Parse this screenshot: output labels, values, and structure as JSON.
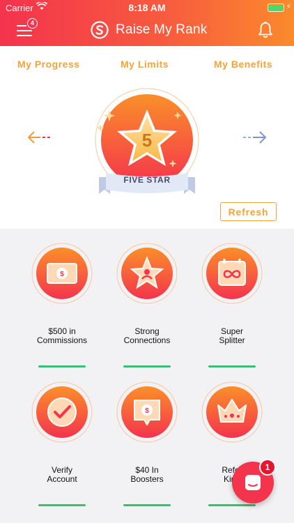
{
  "status_bar": {
    "carrier": "Carrier",
    "time": "8:18 AM"
  },
  "header": {
    "title": "Raise My Rank",
    "menu_badge": "4",
    "menu_icon": "hamburger-menu-icon",
    "bell_icon": "bell-icon",
    "logo_icon": "s-logo-icon"
  },
  "tabs": [
    {
      "label": "My Progress"
    },
    {
      "label": "My Limits"
    },
    {
      "label": "My Benefits"
    }
  ],
  "rank": {
    "number": "5",
    "label": "FIVE STAR"
  },
  "refresh_label": "Refresh",
  "benefits": [
    {
      "title": "$500 in\nCommissions",
      "icon": "money-bill-icon"
    },
    {
      "title": "Strong\nConnections",
      "icon": "star-person-icon"
    },
    {
      "title": "Super\nSplitter",
      "icon": "infinity-card-icon"
    },
    {
      "title": "Verify\nAccount",
      "icon": "checkmark-icon"
    },
    {
      "title": "$40 In\nBoosters",
      "icon": "chat-coin-icon"
    },
    {
      "title": "Refer\nKing",
      "icon": "crown-icon"
    }
  ],
  "chat": {
    "badge": "1"
  },
  "colors": {
    "accent_red": "#f4334d",
    "accent_orange": "#fb8a2c",
    "tab_gold": "#f3a33a",
    "progress_green": "#3dbd72"
  }
}
